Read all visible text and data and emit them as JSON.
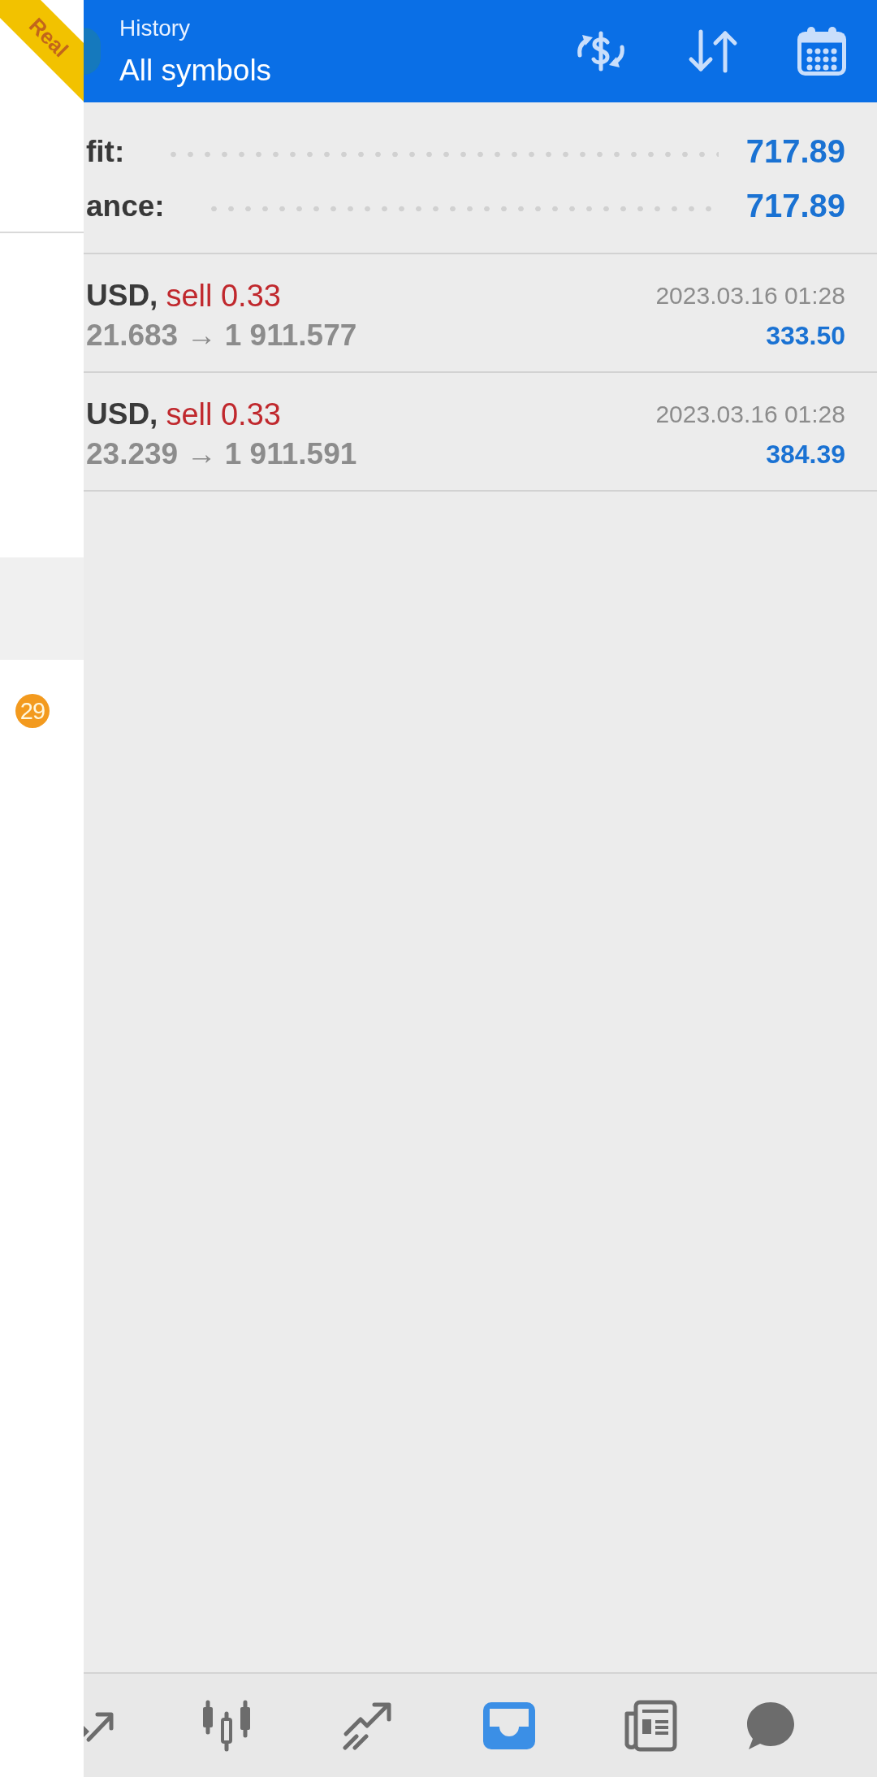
{
  "account_badge": "Real",
  "drawer": {
    "items": [
      {
        "selected": true
      },
      {
        "selected": false,
        "badge": "29"
      }
    ]
  },
  "header": {
    "section": "History",
    "title": "All symbols"
  },
  "summary": [
    {
      "label": "fit:",
      "value": "717.89"
    },
    {
      "label": "ance:",
      "value": "717.89"
    }
  ],
  "trades": [
    {
      "symbol": "USD,",
      "side": "sell 0.33",
      "prices": "21.683 → 1 911.577",
      "time": "2023.03.16 01:28",
      "profit": "333.50"
    },
    {
      "symbol": "USD,",
      "side": "sell 0.33",
      "prices": "23.239 → 1 911.591",
      "time": "2023.03.16 01:28",
      "profit": "384.39"
    }
  ],
  "bottom_nav": {
    "items": [
      {
        "kind": "arrows",
        "selected": false
      },
      {
        "kind": "candles",
        "selected": false
      },
      {
        "kind": "trend",
        "selected": false
      },
      {
        "kind": "inbox",
        "selected": true
      },
      {
        "kind": "news",
        "selected": false
      },
      {
        "kind": "chat",
        "selected": false
      }
    ]
  }
}
